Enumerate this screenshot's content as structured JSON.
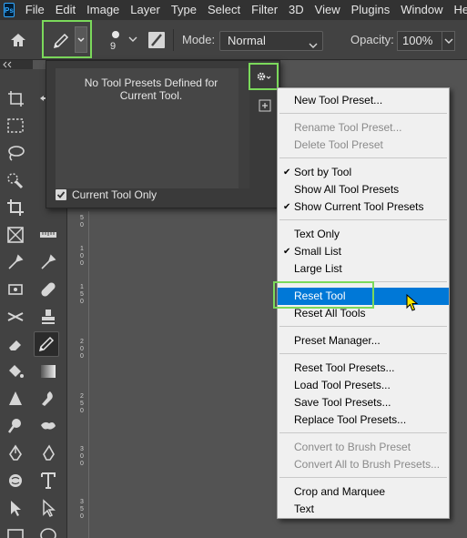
{
  "app": {
    "logo": "Ps"
  },
  "menubar": {
    "items": [
      "File",
      "Edit",
      "Image",
      "Layer",
      "Type",
      "Select",
      "Filter",
      "3D",
      "View",
      "Plugins",
      "Window",
      "Help"
    ]
  },
  "options": {
    "brush_size": "9",
    "mode_label": "Mode:",
    "mode_value": "Normal",
    "opacity_label": "Opacity:",
    "opacity_value": "100%"
  },
  "preset_panel": {
    "empty_line1": "No Tool Presets Defined for",
    "empty_line2": "Current Tool.",
    "current_tool_only": "Current Tool Only",
    "current_tool_only_checked": true
  },
  "ruler": {
    "ticks": [
      "5",
      "0",
      "1",
      "0",
      "0",
      "1",
      "5",
      "0",
      "2",
      "0",
      "0",
      "2",
      "5",
      "0",
      "3",
      "0",
      "0",
      "3",
      "5",
      "0"
    ]
  },
  "menu": {
    "items": [
      {
        "label": "New Tool Preset...",
        "checked": false,
        "disabled": false
      },
      {
        "label": "Rename Tool Preset...",
        "checked": false,
        "disabled": true
      },
      {
        "label": "Delete Tool Preset",
        "checked": false,
        "disabled": true
      },
      {
        "label": "Sort by Tool",
        "checked": true,
        "disabled": false
      },
      {
        "label": "Show All Tool Presets",
        "checked": false,
        "disabled": false
      },
      {
        "label": "Show Current Tool Presets",
        "checked": true,
        "disabled": false
      },
      {
        "label": "Text Only",
        "checked": false,
        "disabled": false
      },
      {
        "label": "Small List",
        "checked": true,
        "disabled": false
      },
      {
        "label": "Large List",
        "checked": false,
        "disabled": false
      },
      {
        "label": "Reset Tool",
        "checked": false,
        "disabled": false,
        "highlighted": true
      },
      {
        "label": "Reset All Tools",
        "checked": false,
        "disabled": false
      },
      {
        "label": "Preset Manager...",
        "checked": false,
        "disabled": false
      },
      {
        "label": "Reset Tool Presets...",
        "checked": false,
        "disabled": false
      },
      {
        "label": "Load Tool Presets...",
        "checked": false,
        "disabled": false
      },
      {
        "label": "Save Tool Presets...",
        "checked": false,
        "disabled": false
      },
      {
        "label": "Replace Tool Presets...",
        "checked": false,
        "disabled": false
      },
      {
        "label": "Convert to Brush Preset",
        "checked": false,
        "disabled": true
      },
      {
        "label": "Convert All to Brush Presets...",
        "checked": false,
        "disabled": true
      },
      {
        "label": "Crop and Marquee",
        "checked": false,
        "disabled": false
      },
      {
        "label": "Text",
        "checked": false,
        "disabled": false
      }
    ],
    "check_glyph": "✔"
  },
  "colors": {
    "highlight": "#0078d7",
    "callout": "#7bd95b"
  }
}
